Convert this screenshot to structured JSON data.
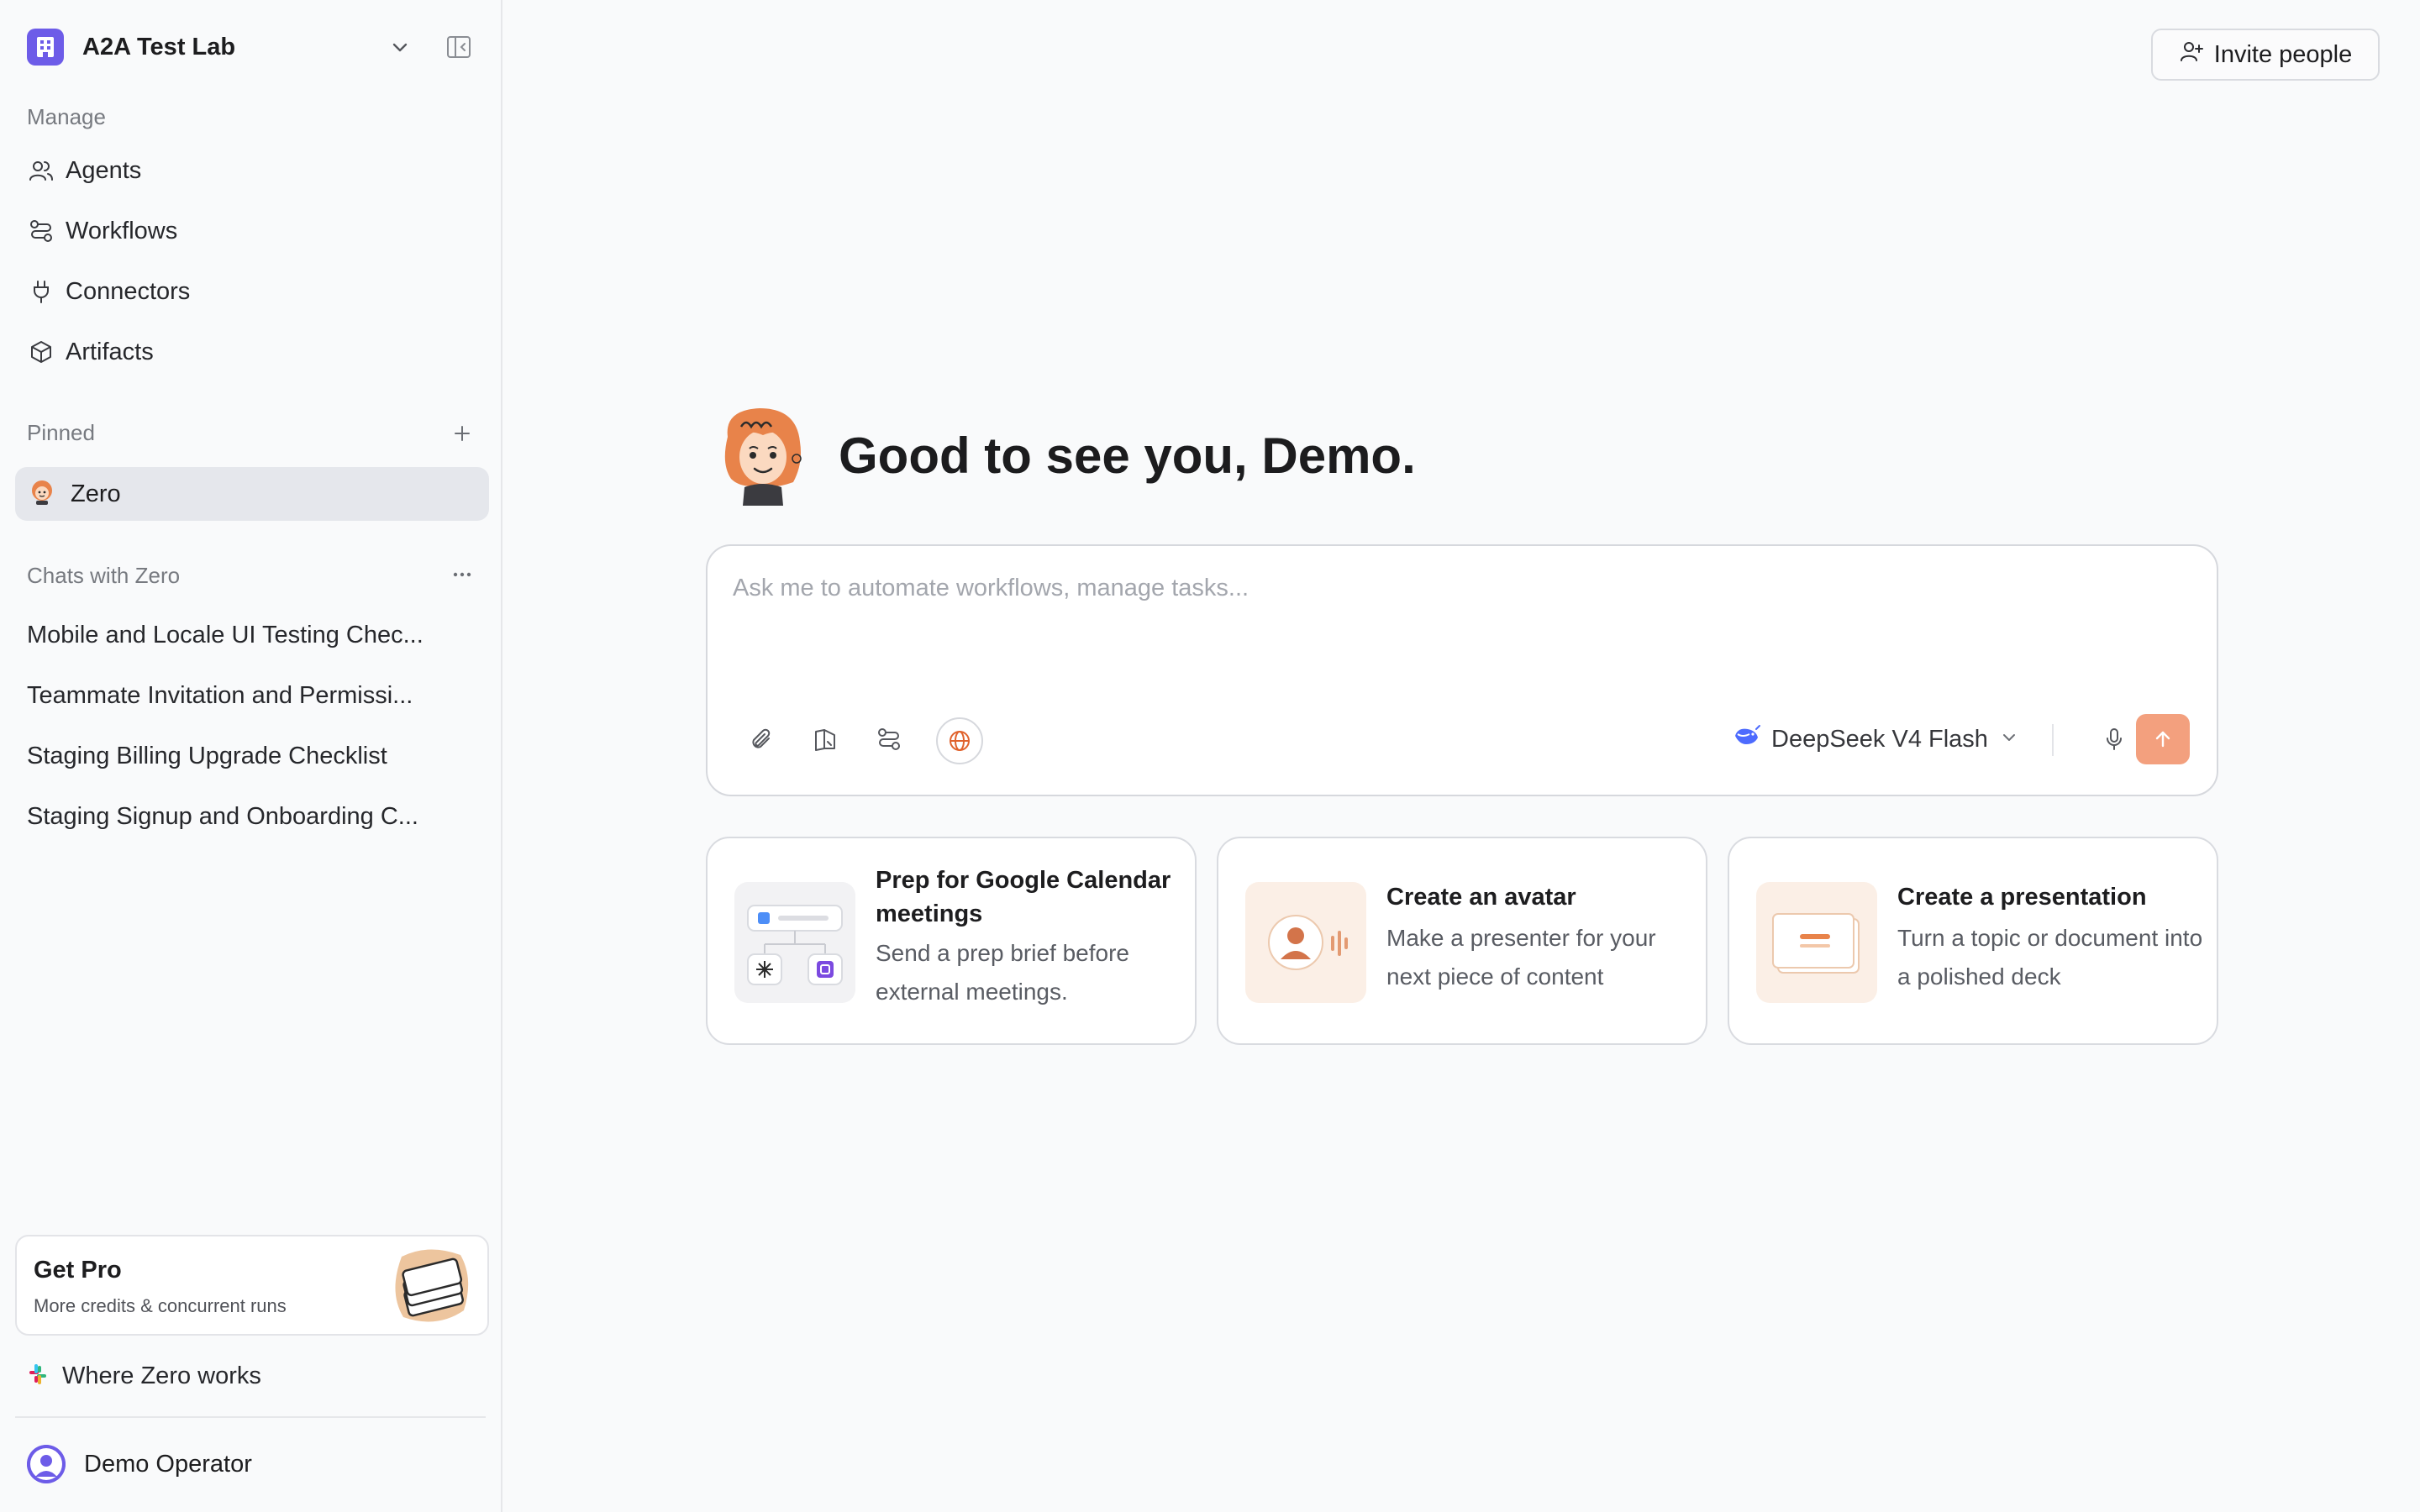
{
  "workspace": {
    "name": "A2A Test Lab"
  },
  "manage": {
    "label": "Manage",
    "items": [
      {
        "label": "Agents"
      },
      {
        "label": "Workflows"
      },
      {
        "label": "Connectors"
      },
      {
        "label": "Artifacts"
      }
    ]
  },
  "pinned": {
    "label": "Pinned",
    "items": [
      {
        "label": "Zero"
      }
    ]
  },
  "chats": {
    "label": "Chats with Zero",
    "items": [
      {
        "label": "Mobile and Locale UI Testing Chec..."
      },
      {
        "label": "Teammate Invitation and Permissi..."
      },
      {
        "label": "Staging Billing Upgrade Checklist"
      },
      {
        "label": "Staging Signup and Onboarding C..."
      }
    ]
  },
  "get_pro": {
    "title": "Get Pro",
    "subtitle": "More credits & concurrent runs"
  },
  "where_zero_works": {
    "label": "Where Zero works"
  },
  "user": {
    "name": "Demo Operator"
  },
  "header": {
    "invite_label": "Invite people"
  },
  "greeting": {
    "text": "Good to see you, Demo."
  },
  "composer": {
    "placeholder": "Ask me to automate workflows, manage tasks...",
    "model": "DeepSeek V4 Flash"
  },
  "cards": [
    {
      "title": "Prep for Google Calendar meetings",
      "description": "Send a prep brief before external meetings."
    },
    {
      "title": "Create an avatar",
      "description": "Make a presenter for your next piece of content"
    },
    {
      "title": "Create a presentation",
      "description": "Turn a topic or document into a polished deck"
    }
  ],
  "colors": {
    "accent": "#6d5ce8",
    "send_button": "#f3a07e",
    "zero_orange": "#e8834a",
    "pinned_bg": "#e5e7ec"
  }
}
